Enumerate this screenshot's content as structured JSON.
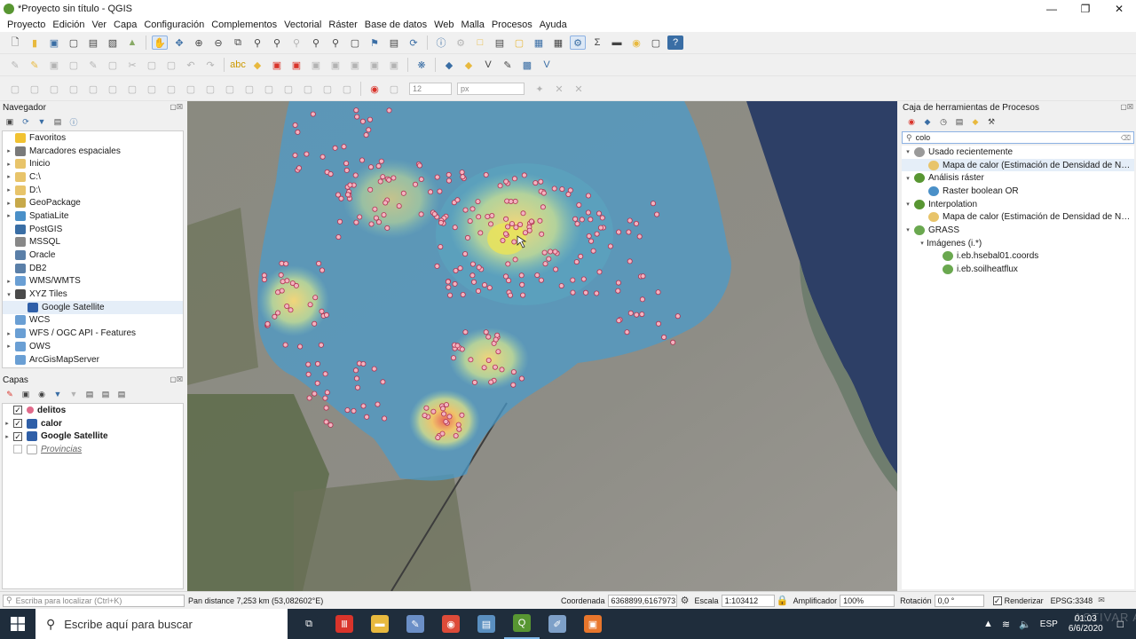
{
  "window": {
    "title": "*Proyecto sin título - QGIS",
    "min_icon": "minimize-icon",
    "max_icon": "maximize-icon",
    "close_icon": "close-icon"
  },
  "menu": [
    "Proyecto",
    "Edición",
    "Ver",
    "Capa",
    "Configuración",
    "Complementos",
    "Vectorial",
    "Ráster",
    "Base de datos",
    "Web",
    "Malla",
    "Procesos",
    "Ayuda"
  ],
  "toolbar_row3": {
    "font_size_value": "12",
    "unit_value": "px"
  },
  "navigator": {
    "title": "Navegador",
    "items": [
      {
        "label": "Favoritos",
        "arrow": "",
        "icon": "star-icon",
        "color": "#f1c232"
      },
      {
        "label": "Marcadores espaciales",
        "arrow": "▸",
        "icon": "bookmark-icon",
        "color": "#7a7a7a"
      },
      {
        "label": "Inicio",
        "arrow": "▸",
        "icon": "folder-icon",
        "color": "#e8c46a"
      },
      {
        "label": "C:\\",
        "arrow": "▸",
        "icon": "folder-icon",
        "color": "#e8c46a"
      },
      {
        "label": "D:\\",
        "arrow": "▸",
        "icon": "folder-icon",
        "color": "#e8c46a"
      },
      {
        "label": "GeoPackage",
        "arrow": "▸",
        "icon": "geopackage-icon",
        "color": "#c7a94a"
      },
      {
        "label": "SpatiaLite",
        "arrow": "▸",
        "icon": "spatialite-icon",
        "color": "#4a90c8"
      },
      {
        "label": "PostGIS",
        "arrow": "",
        "icon": "postgis-icon",
        "color": "#3a6ea5"
      },
      {
        "label": "MSSQL",
        "arrow": "",
        "icon": "mssql-icon",
        "color": "#888888"
      },
      {
        "label": "Oracle",
        "arrow": "",
        "icon": "oracle-icon",
        "color": "#5a7fa8"
      },
      {
        "label": "DB2",
        "arrow": "",
        "icon": "db2-icon",
        "color": "#5a7fa8"
      },
      {
        "label": "WMS/WMTS",
        "arrow": "▸",
        "icon": "globe-icon",
        "color": "#6a9fd4"
      },
      {
        "label": "XYZ Tiles",
        "arrow": "▾",
        "icon": "xyz-tiles-icon",
        "color": "#4a4a4a"
      },
      {
        "label": "Google Satellite",
        "arrow": "",
        "icon": "raster-tile-icon",
        "color": "#2f5fa8",
        "indent": true
      },
      {
        "label": "WCS",
        "arrow": "",
        "icon": "globe-icon",
        "color": "#6a9fd4"
      },
      {
        "label": "WFS / OGC API - Features",
        "arrow": "▸",
        "icon": "globe-icon",
        "color": "#6a9fd4"
      },
      {
        "label": "OWS",
        "arrow": "▸",
        "icon": "globe-icon",
        "color": "#6a9fd4"
      },
      {
        "label": "ArcGisMapServer",
        "arrow": "",
        "icon": "globe-icon",
        "color": "#6a9fd4"
      }
    ]
  },
  "layers": {
    "title": "Capas",
    "items": [
      {
        "label": "delitos",
        "checked": true,
        "bold": true,
        "arrow": "",
        "icon": "point-symbol-icon",
        "color": "#e06a8a"
      },
      {
        "label": "calor",
        "checked": true,
        "bold": true,
        "arrow": "▸",
        "icon": "raster-icon",
        "color": "#2f5fa8"
      },
      {
        "label": "Google Satellite",
        "checked": true,
        "bold": true,
        "arrow": "▸",
        "icon": "raster-icon",
        "color": "#2f5fa8"
      },
      {
        "label": "Provincias",
        "checked": false,
        "bold": false,
        "arrow": "",
        "icon": "polygon-icon",
        "color": "#ffffff"
      }
    ]
  },
  "processing": {
    "title": "Caja de herramientas de Procesos",
    "search_value": "colo",
    "items": [
      {
        "label": "Usado recientemente",
        "arrow": "▾",
        "icon": "clock-icon",
        "color": "#9a9a9a",
        "indent": 0
      },
      {
        "label": "Mapa de calor (Estimación de Densidad de N…",
        "arrow": "",
        "icon": "heatmap-icon",
        "color": "#e8c46a",
        "indent": 1,
        "sel": true
      },
      {
        "label": "Análisis ráster",
        "arrow": "▾",
        "icon": "qgis-icon",
        "color": "#589632",
        "indent": 0
      },
      {
        "label": "Raster boolean OR",
        "arrow": "",
        "icon": "gear-icon",
        "color": "#4a90c8",
        "indent": 1
      },
      {
        "label": "Interpolation",
        "arrow": "▾",
        "icon": "qgis-icon",
        "color": "#589632",
        "indent": 0
      },
      {
        "label": "Mapa de calor (Estimación de Densidad de N…",
        "arrow": "",
        "icon": "heatmap-icon",
        "color": "#e8c46a",
        "indent": 1
      },
      {
        "label": "GRASS",
        "arrow": "▾",
        "icon": "grass-icon",
        "color": "#6aa84f",
        "indent": 0
      },
      {
        "label": "Imágenes (i.*)",
        "arrow": "▾",
        "icon": "",
        "color": "",
        "indent": 1
      },
      {
        "label": "i.eb.hsebal01.coords",
        "arrow": "",
        "icon": "grass-icon",
        "color": "#6aa84f",
        "indent": 2
      },
      {
        "label": "i.eb.soilheatflux",
        "arrow": "",
        "icon": "grass-icon",
        "color": "#6aa84f",
        "indent": 2
      }
    ]
  },
  "status": {
    "locate_placeholder": "Escriba para localizar (Ctrl+K)",
    "message": "Pan distance 7,253 km (53,082602°E)",
    "coord_label": "Coordenada",
    "coord_value": "6368899,6167973",
    "scale_label": "Escala",
    "scale_value": "1:103412",
    "magnifier_label": "Amplificador",
    "magnifier_value": "100%",
    "rotation_label": "Rotación",
    "rotation_value": "0,0 °",
    "render_label": "Renderizar",
    "crs_label": "EPSG:3348"
  },
  "taskbar": {
    "search_placeholder": "Escribe aquí para buscar",
    "lang": "ESP",
    "time": "01:03",
    "date": "6/6/2020",
    "apps": [
      {
        "name": "taskview-icon",
        "color": "#1f2d3c",
        "glyph": "⧉"
      },
      {
        "name": "red-app-icon",
        "color": "#d9342b",
        "glyph": "Ⅲ"
      },
      {
        "name": "file-explorer-icon",
        "color": "#e8b93e",
        "glyph": "▬"
      },
      {
        "name": "paint-icon",
        "color": "#6b8fc7",
        "glyph": "✎"
      },
      {
        "name": "chrome-icon",
        "color": "#dd4b39",
        "glyph": "◉"
      },
      {
        "name": "notepad-icon",
        "color": "#5a8fc0",
        "glyph": "▤"
      },
      {
        "name": "qgis-taskbar-icon",
        "color": "#589632",
        "glyph": "Q"
      },
      {
        "name": "paint-net-icon",
        "color": "#7ea0c8",
        "glyph": "✐"
      },
      {
        "name": "orange-app-icon",
        "color": "#e8762c",
        "glyph": "▣"
      }
    ]
  },
  "watermark": "ACTIVAR APPS"
}
